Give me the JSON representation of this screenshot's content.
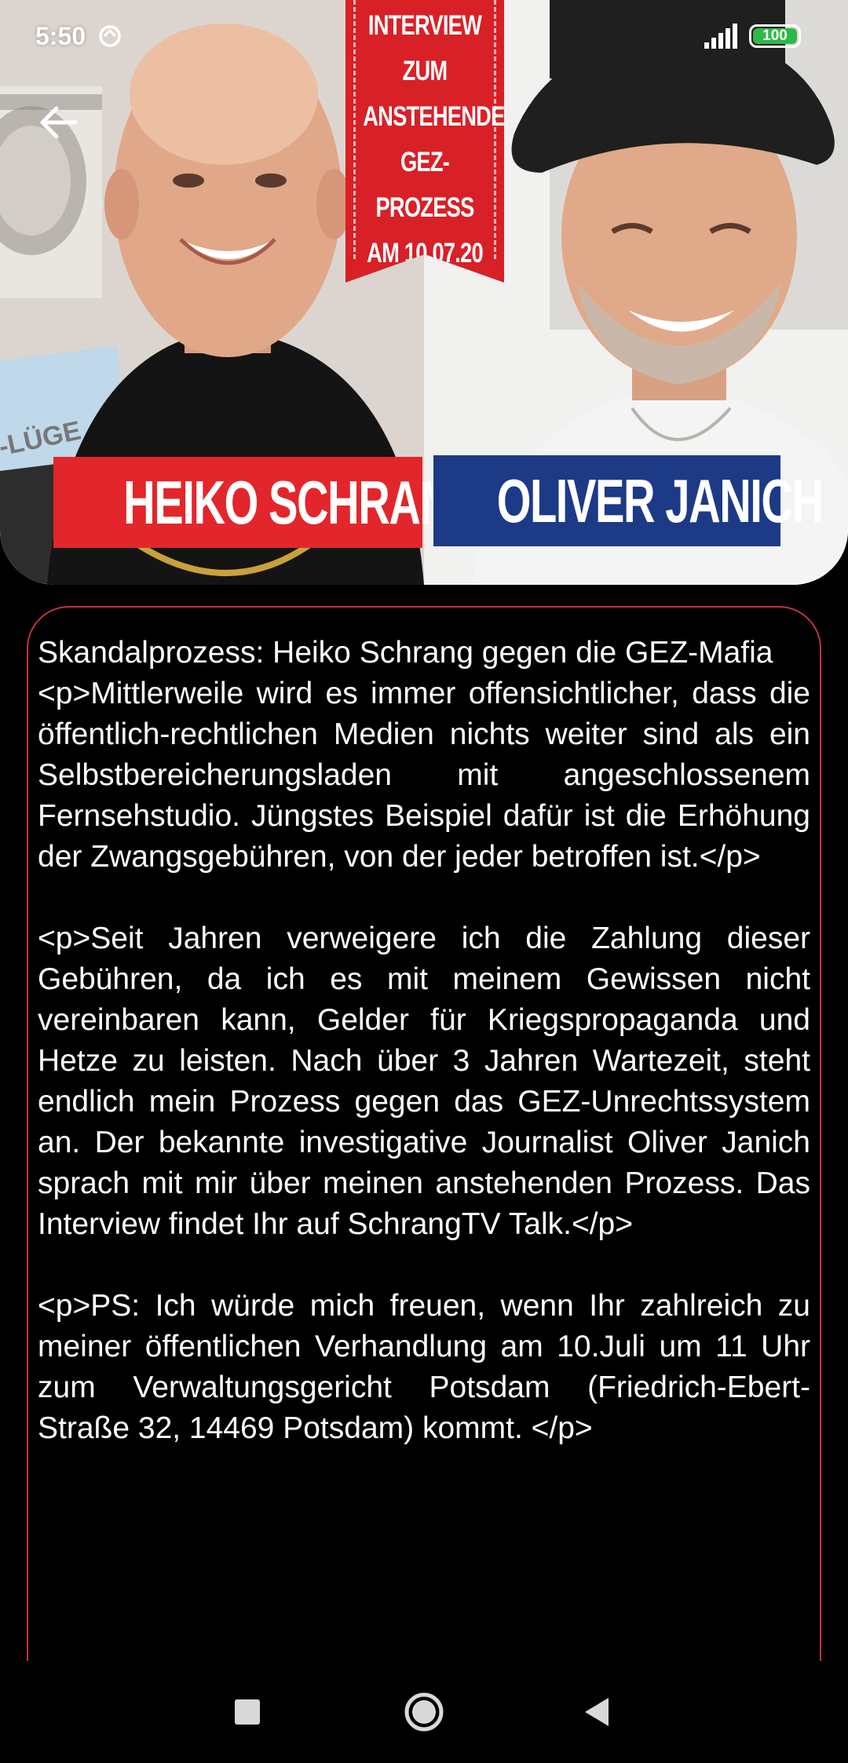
{
  "status_bar": {
    "time": "5:50",
    "battery_level": "100",
    "battery_color": "#2fb84a"
  },
  "hero": {
    "ribbon_lines": [
      "INTERVIEW",
      "ZUM",
      "ANSTEHENDEN",
      "GEZ-PROZESS",
      "AM 10.07.20"
    ],
    "name_left": "HEIKO SCHRANG",
    "name_right": "OLIVER JANICH",
    "book_text": "-LÜGE",
    "colors": {
      "red": "#e3262b",
      "blue": "#1c3a86"
    }
  },
  "article": {
    "title": "Skandalprozess: Heiko Schrang gegen die GEZ-Mafia",
    "paragraphs": [
      "<p>Mittlerweile wird es immer offensichtlicher, dass die öffentlich-rechtlichen Medien nichts weiter sind als ein Selbstbereicherungsladen mit angeschlossenem Fernsehstudio. Jüngstes Beispiel dafür ist die Erhöhung der Zwangsgebühren, von der jeder betroffen ist.</p>",
      "<p>Seit Jahren verweigere ich die Zahlung dieser Gebühren, da ich es mit meinem Gewissen nicht vereinbaren kann, Gelder für Kriegspropaganda und Hetze zu leisten. Nach über 3 Jahren Wartezeit, steht endlich mein Prozess gegen das GEZ-Unrechtssystem an. Der bekannte investigative Journalist Oliver Janich sprach mit mir über meinen anstehenden Prozess. Das Interview findet Ihr auf SchrangTV Talk.</p>",
      "<p>PS: Ich würde mich freuen, wenn Ihr zahlreich zu meiner öffentlichen Verhandlung am 10.Juli um 11 Uhr zum Verwaltungsgericht Potsdam (Friedrich-Ebert-Straße 32, 14469 Potsdam) kommt.  </p>"
    ],
    "border_color": "#c0333a"
  },
  "nav_bar": {
    "icons": [
      "recent-apps-icon",
      "home-icon",
      "back-triangle-icon"
    ]
  }
}
